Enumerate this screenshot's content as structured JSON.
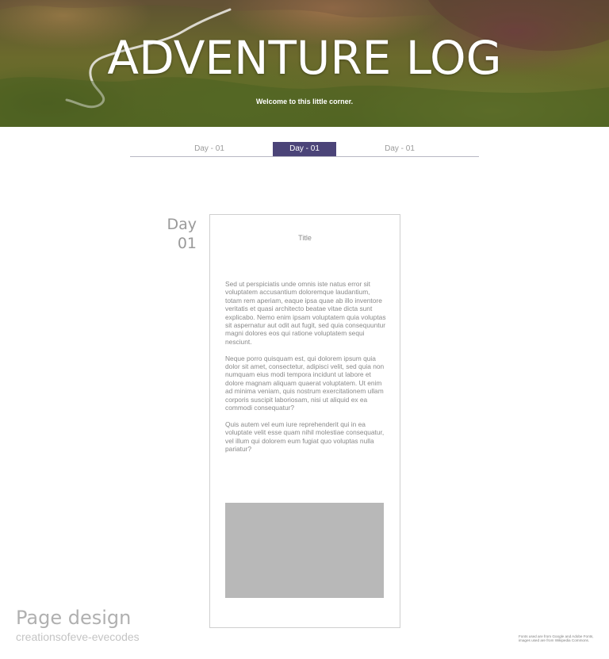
{
  "hero": {
    "title": "ADVENTURE LOG",
    "subtitle": "Welcome to this little corner."
  },
  "tabs": [
    {
      "label": "Day - 01",
      "active": false
    },
    {
      "label": "Day - 01",
      "active": true
    },
    {
      "label": "Day - 01",
      "active": false
    }
  ],
  "entry": {
    "day_word": "Day",
    "day_number": "01",
    "title": "Title",
    "paragraphs": [
      "Sed ut perspiciatis unde omnis iste natus error sit voluptatem accusantium doloremque laudantium, totam rem aperiam, eaque ipsa quae ab illo inventore veritatis et quasi architecto beatae vitae dicta sunt explicabo. Nemo enim ipsam voluptatem quia voluptas sit aspernatur aut odit aut fugit, sed quia consequuntur magni dolores eos qui ratione voluptatem sequi nesciunt.",
      "Neque porro quisquam est, qui dolorem ipsum quia dolor sit amet, consectetur, adipisci velit, sed quia non numquam eius modi tempora incidunt ut labore et dolore magnam aliquam quaerat voluptatem. Ut enim ad minima veniam, quis nostrum exercitationem ullam corporis suscipit laboriosam, nisi ut aliquid ex ea commodi consequatur?",
      "Quis autem vel eum iure reprehenderit qui in ea voluptate velit esse quam nihil molestiae consequatur, vel illum qui dolorem eum fugiat quo voluptas nulla pariatur?"
    ]
  },
  "footer": {
    "title": "Page design",
    "subtitle": "creationsofeve-evecodes",
    "note": "Fonts used are from Google and Adobe Fonts, images used are from Wikipedia Commons."
  },
  "colors": {
    "accent": "#4b4478",
    "placeholder_image": "#b8b8b8",
    "text_muted": "#8a8a8a"
  }
}
